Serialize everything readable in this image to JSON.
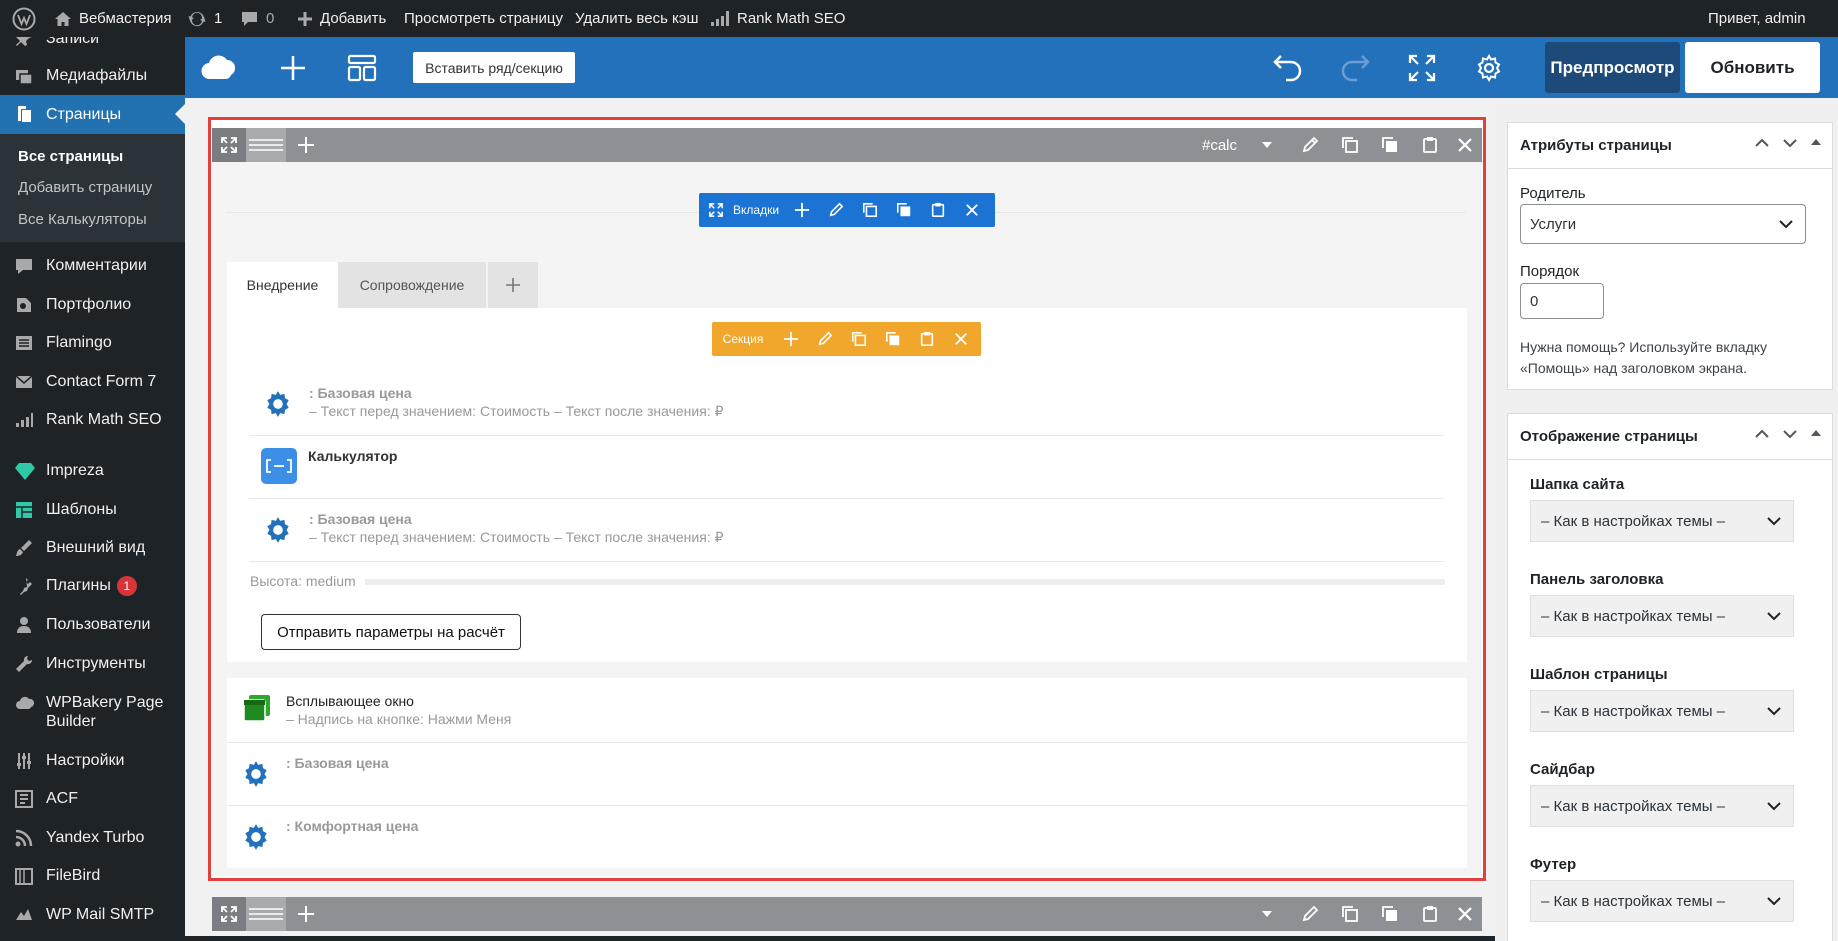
{
  "adminbar": {
    "site_name": "Вебмастерия",
    "updates_count": "1",
    "comments_count": "0",
    "add_label": "Добавить",
    "view_page": "Просмотреть страницу",
    "clear_cache": "Удалить весь кэш",
    "rank_math": "Rank Math SEO",
    "greeting": "Привет, admin"
  },
  "sidebar": {
    "items": [
      {
        "label": "Записи"
      },
      {
        "label": "Медиафайлы"
      },
      {
        "label": "Страницы"
      },
      {
        "label": "Комментарии"
      },
      {
        "label": "Портфолио"
      },
      {
        "label": "Flamingo"
      },
      {
        "label": "Contact Form 7"
      },
      {
        "label": "Rank Math SEO"
      },
      {
        "label": "Impreza"
      },
      {
        "label": "Шаблоны"
      },
      {
        "label": "Внешний вид"
      },
      {
        "label": "Плагины",
        "badge": "1"
      },
      {
        "label": "Пользователи"
      },
      {
        "label": "Инструменты"
      },
      {
        "label": "WPBakery Page Builder"
      },
      {
        "label": "Настройки"
      },
      {
        "label": "ACF"
      },
      {
        "label": "Yandex Turbo"
      },
      {
        "label": "FileBird"
      },
      {
        "label": "WP Mail SMTP"
      }
    ],
    "submenu": [
      "Все страницы",
      "Добавить страницу",
      "Все Калькуляторы"
    ]
  },
  "toolbar": {
    "insert_row": "Вставить ряд/секцию",
    "preview": "Предпросмотр",
    "update": "Обновить"
  },
  "editor": {
    "row_id": "#calc",
    "tabs_label": "Вкладки",
    "section_label": "Секция",
    "tabs": [
      "Внедрение",
      "Сопровождение"
    ],
    "elements": [
      {
        "title": ": Базовая цена",
        "subtitle": "– Текст перед значением: Стоимость – Текст после значения: ₽"
      },
      {
        "title": "Калькулятор",
        "subtitle": ""
      },
      {
        "title": ": Базовая цена",
        "subtitle": "– Текст перед значением: Стоимость – Текст после значения: ₽"
      }
    ],
    "spacer_label": "Высота: medium",
    "submit_button": "Отправить параметры на расчёт",
    "popup_title": "Всплывающее окно",
    "popup_sub": "– Надпись на кнопке: Нажми Меня",
    "base_price": ": Базовая цена",
    "comfort_price": ": Комфортная цена"
  },
  "page_attributes": {
    "title": "Атрибуты страницы",
    "parent_label": "Родитель",
    "parent_value": "Услуги",
    "order_label": "Порядок",
    "order_value": "0",
    "help": "Нужна помощь? Используйте вкладку «Помощь» над заголовком экрана."
  },
  "page_display": {
    "title": "Отображение страницы",
    "fields": [
      {
        "label": "Шапка сайта",
        "value": "– Как в настройках темы –"
      },
      {
        "label": "Панель заголовка",
        "value": "– Как в настройках темы –"
      },
      {
        "label": "Шаблон страницы",
        "value": "– Как в настройках темы –"
      },
      {
        "label": "Сайдбар",
        "value": "– Как в настройках темы –"
      },
      {
        "label": "Футер",
        "value": "– Как в настройках темы –"
      }
    ]
  },
  "colors": {
    "accent": "#2370bb",
    "tabs_control": "#1b74d3",
    "section_control": "#f0a72c",
    "highlight": "#e0413a"
  }
}
